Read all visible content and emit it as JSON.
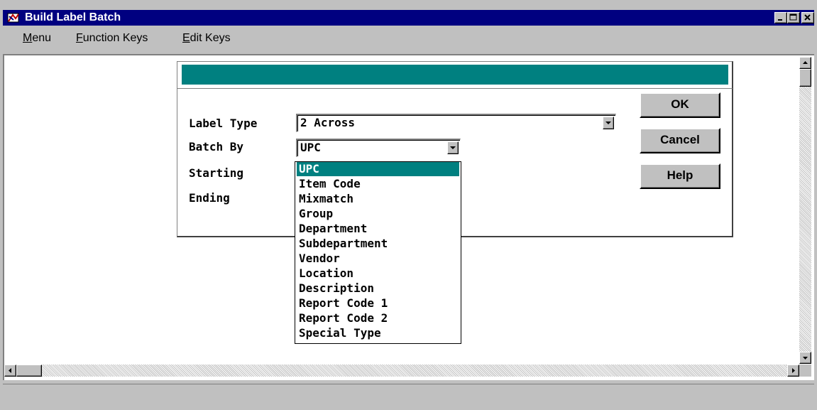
{
  "window": {
    "title": "Build Label Batch",
    "title_bar_color": "#000080",
    "icons": {
      "app": "app-icon",
      "minimize": "minimize-icon",
      "maximize": "maximize-icon",
      "close": "close-icon"
    }
  },
  "menubar": {
    "items": [
      {
        "accel": "M",
        "rest": "enu"
      },
      {
        "accel": "F",
        "rest": "unction Keys"
      },
      {
        "accel": "E",
        "rest": "dit Keys"
      }
    ]
  },
  "dialog": {
    "header_color": "#008080",
    "fields": {
      "label_type": {
        "label": "Label Type",
        "value": "2 Across"
      },
      "batch_by": {
        "label": "Batch By",
        "value": "UPC"
      },
      "starting": {
        "label": "Starting"
      },
      "ending": {
        "label": "Ending"
      }
    },
    "buttons": {
      "ok": "OK",
      "cancel": "Cancel",
      "help": "Help"
    }
  },
  "dropdown": {
    "selected": "UPC",
    "selected_color": "#008080",
    "options": [
      "UPC",
      "Item Code",
      "Mixmatch",
      "Group",
      "Department",
      "Subdepartment",
      "Vendor",
      "Location",
      "Description",
      "Report Code 1",
      "Report Code 2",
      "Special Type"
    ]
  }
}
